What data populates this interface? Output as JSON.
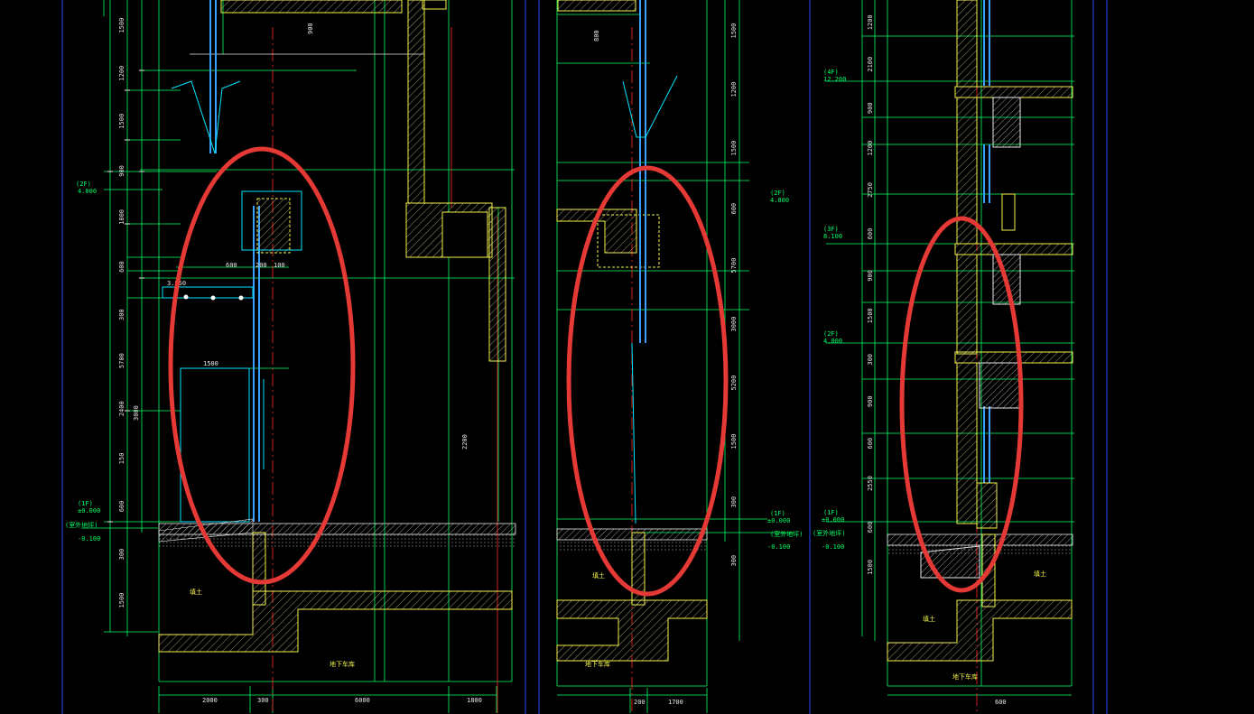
{
  "colors": {
    "background": "#000000",
    "dimension": "#00ff66",
    "wall": "#f2f24a",
    "hatch": "#c8c8c8",
    "glass": "#3aa0ff",
    "cyan": "#00e5ff",
    "annotation_circle": "#e53935",
    "axis": "#ff2a2a",
    "border": "#2a4cff"
  },
  "left": {
    "level_2f": "(2F)",
    "level_2f_value": "4.000",
    "level_1f": "(1F)",
    "level_1f_value": "±0.000",
    "outdoor": "(室外地坪)",
    "outdoor_value": "-0.100",
    "dims_vertical": [
      "1500",
      "1200",
      "1500",
      "900",
      "1800",
      "600",
      "300",
      "5700",
      "2400",
      "150",
      "600",
      "300",
      "1500"
    ],
    "dims_bottom": [
      "2000",
      "300",
      "6000",
      "1800"
    ],
    "dim_300": "200",
    "dim_100": "100",
    "dim_1500_mid": "1500",
    "dim_600": "600",
    "dim_2200": "2200",
    "dim_3000": "3000",
    "dim_900_top": "900",
    "label_soil": "填土",
    "label_basement": "地下车库",
    "label_elev": "3.850"
  },
  "mid": {
    "level_2f": "(2F)",
    "level_2f_value": "4.000",
    "level_1f": "(1F)",
    "level_1f_value": "±0.000",
    "outdoor": "(室外地坪)",
    "outdoor_value": "-0.100",
    "dims_right": [
      "1500",
      "1200",
      "1500",
      "600",
      "5700",
      "3000",
      "5200",
      "1500",
      "300",
      "300"
    ],
    "dims_bottom": [
      "200",
      "1700"
    ],
    "dim_800": "800",
    "label_soil": "填土",
    "label_basement": "地下车库"
  },
  "right": {
    "level_4f": "(4F)",
    "level_4f_value": "12.200",
    "level_3f": "(3F)",
    "level_3f_value": "8.100",
    "level_2f": "(2F)",
    "level_2f_value": "4.000",
    "level_1f": "(1F)",
    "level_1f_value": "±0.000",
    "outdoor": "(室外地坪)",
    "outdoor_value": "-0.100",
    "dims_left": [
      "1200",
      "2100",
      "900",
      "1200",
      "2750",
      "600",
      "900",
      "1500",
      "300",
      "900",
      "600",
      "2550",
      "600",
      "1500"
    ],
    "dims_bottom": [
      "600"
    ],
    "label_soil": "填土",
    "label_basement": "地下车库"
  }
}
